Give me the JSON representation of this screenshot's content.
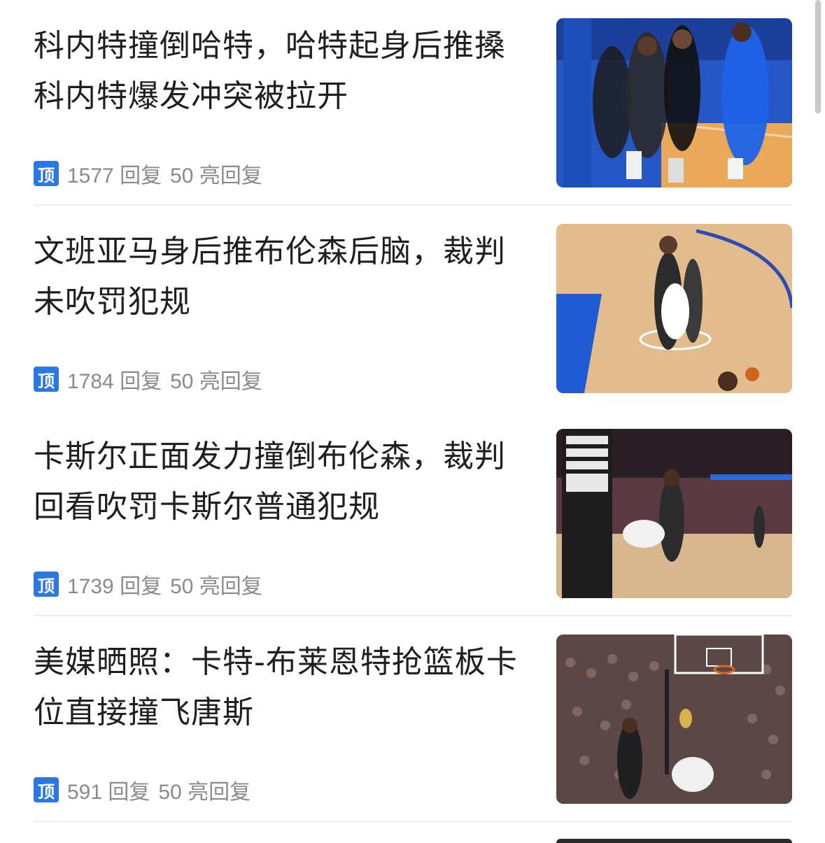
{
  "feed": {
    "items": [
      {
        "title": "科内特撞倒哈特，哈特起身后推搡科内特爆发冲突被拉开",
        "badge": "顶",
        "replies": "1577 回复",
        "light_replies": "50 亮回复",
        "thumbnail_scene": "blue-court-scuffle"
      },
      {
        "title": "文班亚马身后推布伦森后脑，裁判未吹罚犯规",
        "badge": "顶",
        "replies": "1784 回复",
        "light_replies": "50 亮回复",
        "thumbnail_scene": "wood-court-play"
      },
      {
        "title": "卡斯尔正面发力撞倒布伦森，裁判回看吹罚卡斯尔普通犯规",
        "badge": "顶",
        "replies": "1739 回复",
        "light_replies": "50 亮回复",
        "thumbnail_scene": "referee-collision"
      },
      {
        "title": "美媒晒照：卡特-布莱恩特抢篮板卡位直接撞飞唐斯",
        "badge": "顶",
        "replies": "591 回复",
        "light_replies": "50 亮回复",
        "thumbnail_scene": "crowd-rebound"
      }
    ]
  },
  "colors": {
    "badge_blue": "#2b78e4",
    "meta_gray": "#8a8a8a",
    "title_black": "#1f1f1f"
  },
  "icons": {
    "badge": "ding-badge-icon"
  }
}
